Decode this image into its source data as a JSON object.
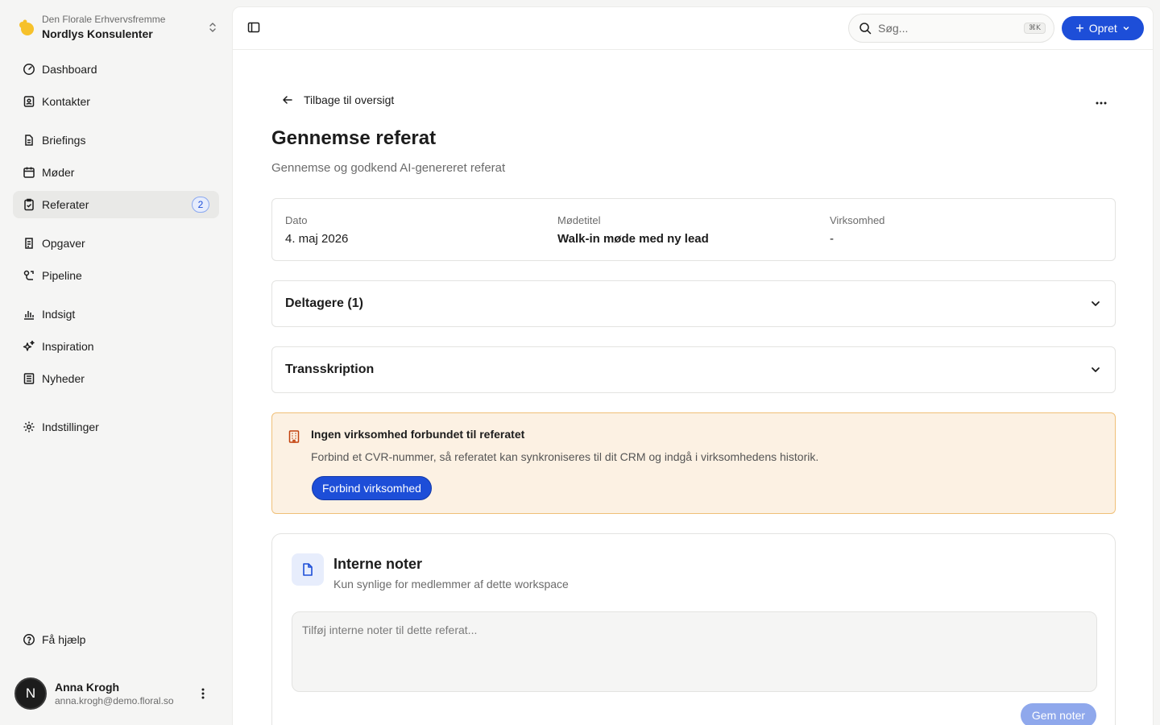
{
  "workspace": {
    "org": "Den Florale Erhvervsfremme",
    "name": "Nordlys Konsulenter"
  },
  "nav": {
    "dashboard": "Dashboard",
    "kontakter": "Kontakter",
    "briefings": "Briefings",
    "moder": "Møder",
    "referater": "Referater",
    "referater_badge": "2",
    "opgaver": "Opgaver",
    "pipeline": "Pipeline",
    "indsigt": "Indsigt",
    "inspiration": "Inspiration",
    "nyheder": "Nyheder",
    "indstillinger": "Indstillinger",
    "help": "Få hjælp"
  },
  "user": {
    "initial": "N",
    "name": "Anna Krogh",
    "email": "anna.krogh@demo.floral.so"
  },
  "topbar": {
    "search_placeholder": "Søg...",
    "search_shortcut": "⌘K",
    "create_label": "Opret"
  },
  "page": {
    "back_label": "Tilbage til oversigt",
    "title": "Gennemse referat",
    "subtitle": "Gennemse og godkend AI-genereret referat"
  },
  "meta": {
    "date_label": "Dato",
    "date_value": "4. maj 2026",
    "title_label": "Mødetitel",
    "title_value": "Walk-in møde med ny lead",
    "company_label": "Virksomhed",
    "company_value": "-"
  },
  "sections": {
    "participants": "Deltagere (1)",
    "transcription": "Transskription"
  },
  "alert": {
    "title": "Ingen virksomhed forbundet til referatet",
    "text": "Forbind et CVR-nummer, så referatet kan synkroniseres til dit CRM og indgå i virksomhedens historik.",
    "button": "Forbind virksomhed"
  },
  "notes": {
    "title": "Interne noter",
    "subtitle": "Kun synlige for medlemmer af dette workspace",
    "placeholder": "Tilføj interne noter til dette referat...",
    "save_label": "Gem noter"
  },
  "colors": {
    "accent": "#1d4ed8",
    "alert_bg": "#fcf1e3",
    "alert_border": "#f0c078",
    "alert_icon": "#c2410c"
  }
}
